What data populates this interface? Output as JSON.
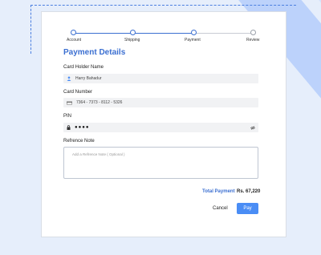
{
  "steps": [
    {
      "label": "Account",
      "state": "done"
    },
    {
      "label": "Shipping",
      "state": "done"
    },
    {
      "label": "Payment",
      "state": "current"
    },
    {
      "label": "Review",
      "state": "pending"
    }
  ],
  "form": {
    "title": "Payment Details",
    "card_holder": {
      "label": "Card Holder Name",
      "value": "Harry Bahadur",
      "icon": "user-icon"
    },
    "card_number": {
      "label": "Card Number",
      "value": "7364 - 7373 - 8112 - 5326",
      "icon": "card-icon"
    },
    "pin": {
      "label": "PIN",
      "value": "●●●●",
      "icon": "lock-icon",
      "toggle_icon": "eye-off-icon"
    },
    "note": {
      "label": "Refrence Note",
      "placeholder": "Add a Refrence Note ( Optional )"
    }
  },
  "summary": {
    "total_label": "Total Payment",
    "total_amount": "Rs. 67,220"
  },
  "actions": {
    "cancel_label": "Cancel",
    "pay_label": "Pay"
  },
  "colors": {
    "accent": "#3b6fd1",
    "button": "#4a8df5",
    "background": "#e6eefb"
  }
}
